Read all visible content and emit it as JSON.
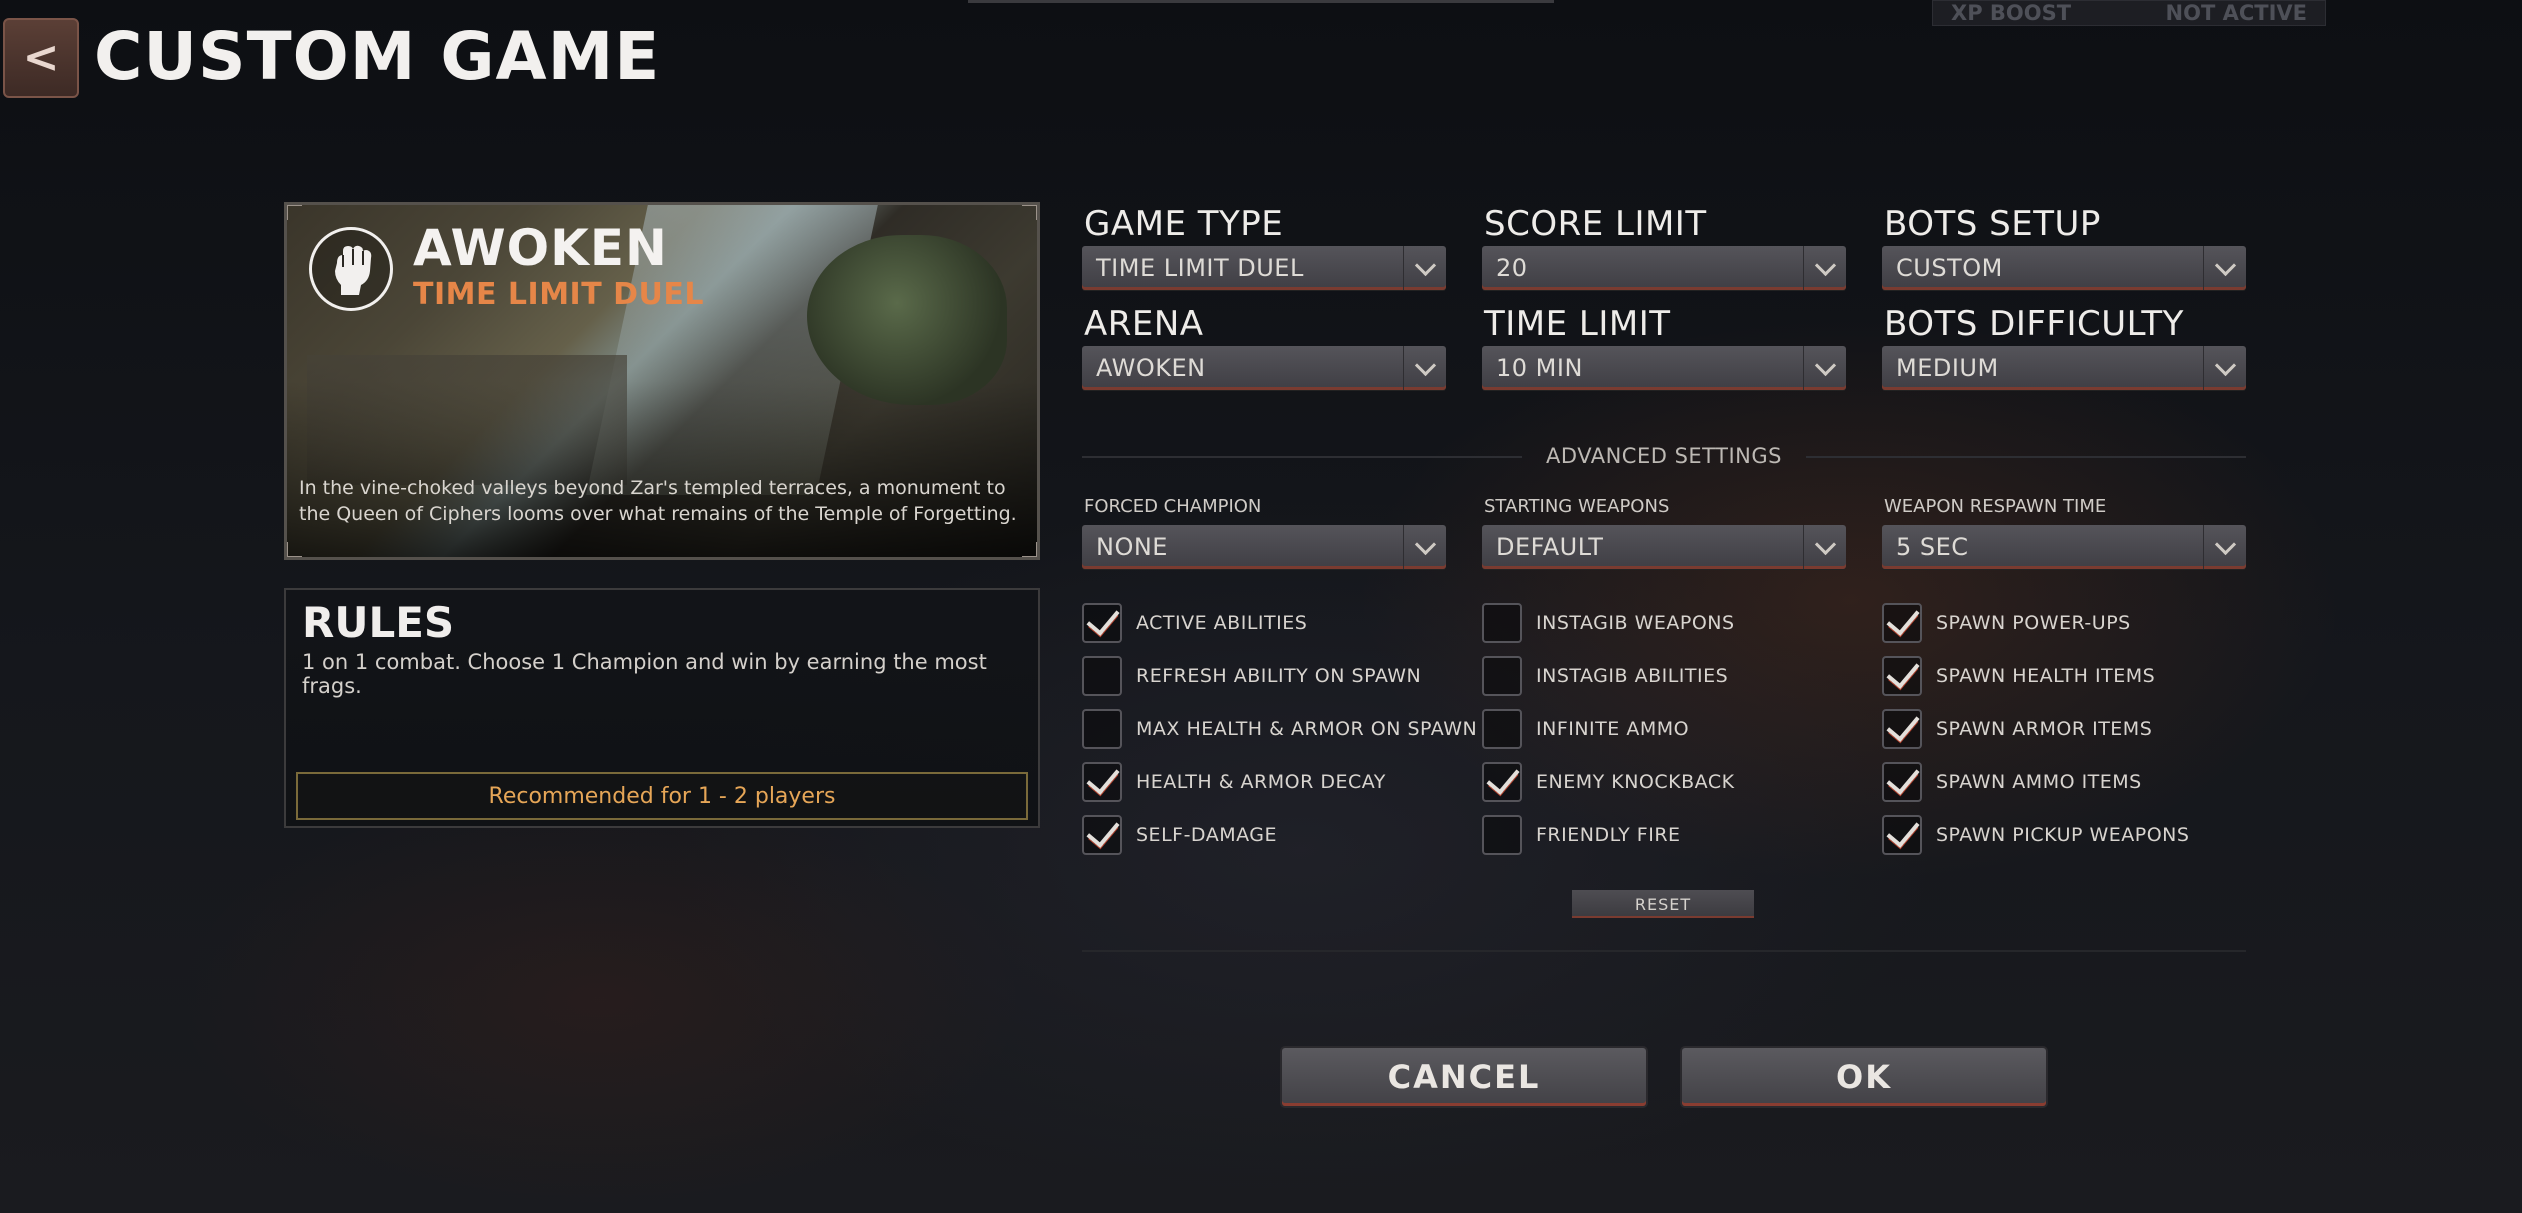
{
  "header": {
    "title": "CUSTOM GAME",
    "back_symbol": "<"
  },
  "xp_boost": {
    "label": "XP BOOST",
    "status": "NOT ACTIVE"
  },
  "map_card": {
    "name": "AWOKEN",
    "mode": "TIME LIMIT DUEL",
    "description": "In the vine-choked valleys beyond Zar's templed terraces, a monument to the Queen of Ciphers looms over what remains of the Temple of Forgetting.",
    "emblem_icon": "raised-fist-icon"
  },
  "rules": {
    "title": "RULES",
    "text": "1 on 1 combat. Choose 1 Champion and win by earning the most frags.",
    "recommended": "Recommended for  1 -  2 players"
  },
  "settings": {
    "game_type": {
      "label": "GAME TYPE",
      "value": "TIME LIMIT DUEL"
    },
    "score_limit": {
      "label": "SCORE LIMIT",
      "value": "20"
    },
    "bots_setup": {
      "label": "BOTS SETUP",
      "value": "CUSTOM"
    },
    "arena": {
      "label": "ARENA",
      "value": "AWOKEN"
    },
    "time_limit": {
      "label": "TIME LIMIT",
      "value": "10 MIN"
    },
    "bots_difficulty": {
      "label": "BOTS DIFFICULTY",
      "value": "MEDIUM"
    }
  },
  "advanced": {
    "title": "ADVANCED SETTINGS",
    "forced_champion": {
      "label": "FORCED CHAMPION",
      "value": "NONE"
    },
    "starting_weapons": {
      "label": "STARTING WEAPONS",
      "value": "DEFAULT"
    },
    "weapon_respawn": {
      "label": "WEAPON RESPAWN TIME",
      "value": "5 SEC"
    },
    "checkboxes": {
      "col1": [
        {
          "label": "ACTIVE ABILITIES",
          "checked": true
        },
        {
          "label": "REFRESH ABILITY ON SPAWN",
          "checked": false
        },
        {
          "label": "MAX HEALTH & ARMOR ON SPAWN",
          "checked": false
        },
        {
          "label": "HEALTH & ARMOR DECAY",
          "checked": true
        },
        {
          "label": "SELF-DAMAGE",
          "checked": true
        }
      ],
      "col2": [
        {
          "label": "INSTAGIB WEAPONS",
          "checked": false
        },
        {
          "label": "INSTAGIB ABILITIES",
          "checked": false
        },
        {
          "label": "INFINITE AMMO",
          "checked": false
        },
        {
          "label": "ENEMY KNOCKBACK",
          "checked": true
        },
        {
          "label": "FRIENDLY FIRE",
          "checked": false
        }
      ],
      "col3": [
        {
          "label": "SPAWN POWER-UPS",
          "checked": true
        },
        {
          "label": "SPAWN HEALTH ITEMS",
          "checked": true
        },
        {
          "label": "SPAWN ARMOR ITEMS",
          "checked": true
        },
        {
          "label": "SPAWN AMMO ITEMS",
          "checked": true
        },
        {
          "label": "SPAWN PICKUP WEAPONS",
          "checked": true
        }
      ]
    },
    "reset_label": "RESET"
  },
  "buttons": {
    "cancel": "CANCEL",
    "ok": "OK"
  }
}
